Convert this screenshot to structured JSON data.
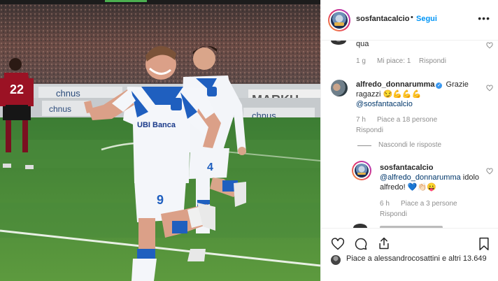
{
  "post": {
    "username": "sosfantacalcio",
    "separator": "•",
    "follow_label": "Segui",
    "more_icon": "more-dots-icon"
  },
  "photo": {
    "kit_sponsor": "UBI Banca",
    "player_front_number": "9",
    "player_back_number": "4",
    "opponent_number": "22",
    "board_text_1": "chnus",
    "board_text_2": "MARKU",
    "board_text_3": "chnus",
    "board_text_4": "chnus"
  },
  "comments": [
    {
      "text": "qua",
      "time": "1 g",
      "likes": "Mi piace: 1",
      "reply_label": "Rispondi"
    },
    {
      "username": "alfredo_donnarumma",
      "verified": "✓",
      "text": "Grazie ragazzi 😏💪💪💪",
      "mention": "@sosfantacalcio",
      "time": "7 h",
      "likes": "Piace a 18 persone",
      "reply_label": "Rispondi",
      "hide_replies_label": "Nascondi le risposte"
    },
    {
      "username": "sosfantacalcio",
      "mention": "@alfredo_donnarumma",
      "text": "idolo alfredo! 💙👏🏻😛",
      "time": "6 h",
      "likes": "Piace a 3 persone",
      "reply_label": "Rispondi"
    }
  ],
  "actions": {
    "like_icon": "heart-icon",
    "comment_icon": "comment-icon",
    "share_icon": "share-icon",
    "save_icon": "bookmark-icon",
    "liked_by": "Piace a alessandrocosattini e altri 13.649"
  },
  "colors": {
    "link_blue": "#0095f6",
    "text_dark": "#262626",
    "text_muted": "#8e8e8e",
    "pitch_green": "#4f8a3a",
    "kit_blue": "#1f5fbf"
  }
}
